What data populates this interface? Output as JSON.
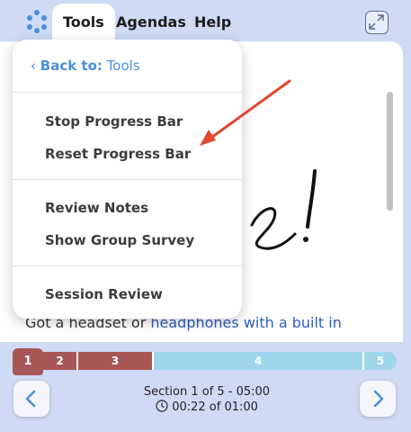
{
  "topbar": {
    "menus": [
      {
        "label": "Tools"
      },
      {
        "label": "Agendas"
      },
      {
        "label": "Help"
      }
    ]
  },
  "dropdown": {
    "back_prefix": "Back to:",
    "back_target": "Tools",
    "groups": [
      [
        "Stop Progress Bar",
        "Reset Progress Bar"
      ],
      [
        "Review Notes",
        "Show Group Survey"
      ],
      [
        "Session Review"
      ]
    ]
  },
  "content": {
    "text_before": "Got a headset or ",
    "link_text": "headphones with a built in"
  },
  "progress": {
    "current_segment": "1",
    "segments": [
      "1",
      "2",
      "3",
      "4",
      "5"
    ],
    "completed_segments": 3
  },
  "footer": {
    "section_text": "Section 1 of 5 - 05:00",
    "time_text": "00:22 of 01:00"
  },
  "colors": {
    "accent_blue": "#4a90d9",
    "progress_done": "#a85757",
    "progress_todo": "#9fd6ec",
    "annotation_arrow": "#e2462f"
  },
  "icons": [
    "logo-dots-icon",
    "expand-icon",
    "chevron-left-icon",
    "chevron-right-icon",
    "clock-icon"
  ]
}
